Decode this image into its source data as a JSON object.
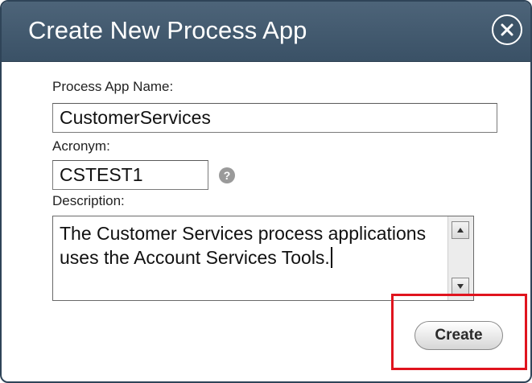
{
  "dialog": {
    "title": "Create New Process App"
  },
  "form": {
    "name_label": "Process App Name:",
    "name_value": "CustomerServices",
    "acronym_label": "Acronym:",
    "acronym_value": "CSTEST1",
    "help_glyph": "?",
    "description_label": "Description:",
    "description_value": "The Customer Services process applications uses the Account Services Tools."
  },
  "actions": {
    "create_label": "Create"
  },
  "colors": {
    "titlebar": "#3f566b",
    "highlight": "#e0141e"
  }
}
